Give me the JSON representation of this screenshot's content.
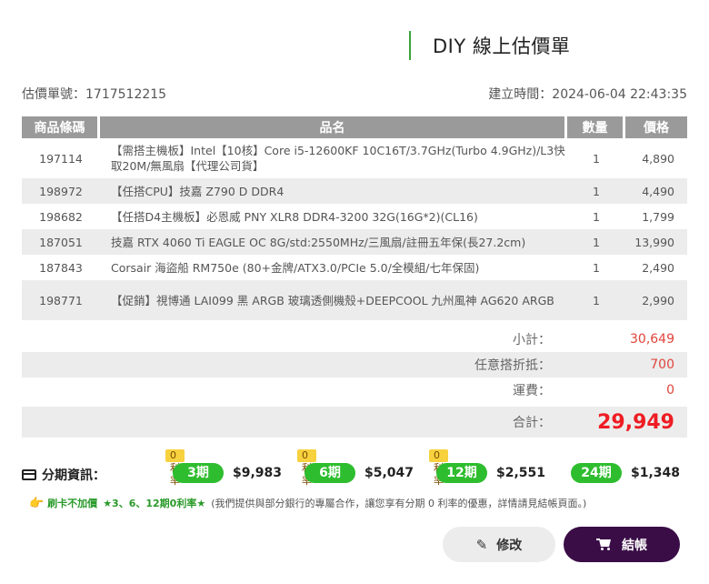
{
  "header": {
    "title": "DIY 線上估價單"
  },
  "meta": {
    "quote_no": "估價單號：1717512215",
    "created": "建立時間：2024-06-04 22:43:35"
  },
  "table": {
    "columns": [
      "商品條碼",
      "品名",
      "數量",
      "價格"
    ],
    "rows": [
      {
        "code": "197114",
        "name": "【需搭主機板】Intel【10核】Core i5-12600KF 10C16T/3.7GHz(Turbo 4.9GHz)/L3快取20M/無風扇【代理公司貨】",
        "qty": "1",
        "price": "4,890"
      },
      {
        "code": "198972",
        "name": "【任搭CPU】技嘉 Z790 D DDR4",
        "qty": "1",
        "price": "4,490"
      },
      {
        "code": "198682",
        "name": "【任搭D4主機板】必恩威 PNY XLR8 DDR4-3200 32G(16G*2)(CL16)",
        "qty": "1",
        "price": "1,799"
      },
      {
        "code": "187051",
        "name": "技嘉 RTX 4060 Ti EAGLE OC 8G/std:2550MHz/三風扇/註冊五年保(長27.2cm)",
        "qty": "1",
        "price": "13,990"
      },
      {
        "code": "187843",
        "name": "Corsair 海盜船 RM750e (80+金牌/ATX3.0/PCIe 5.0/全模組/七年保固)",
        "qty": "1",
        "price": "2,490"
      },
      {
        "code": "198771",
        "name": "【促銷】視博通 LAI099 黑 ARGB 玻璃透側機殼+DEEPCOOL 九州風神 AG620 ARGB",
        "qty": "1",
        "price": "2,990"
      }
    ]
  },
  "summary": {
    "subtotal_label": "小計：",
    "subtotal": "30,649",
    "discount_label": "任意搭折抵：",
    "discount": "700",
    "shipping_label": "運費：",
    "shipping": "0",
    "total_label": "合計：",
    "total": "29,949"
  },
  "installment": {
    "label": "分期資訊：",
    "plans": [
      {
        "tag": "0利率",
        "term": "3期",
        "price": "$9,983"
      },
      {
        "tag": "0利率",
        "term": "6期",
        "price": "$5,047"
      },
      {
        "tag": "0利率",
        "term": "12期",
        "price": "$2,551"
      },
      {
        "tag": "",
        "term": "24期",
        "price": "$1,348"
      }
    ]
  },
  "promo": {
    "a": "刷卡不加價",
    "b": "★3、6、12期0利率★",
    "c": "(我們提供與部分銀行的專屬合作，讓您享有分期 0 利率的優惠，詳情請見結帳頁面。)"
  },
  "buttons": {
    "edit": "修改",
    "checkout": "結帳"
  },
  "colors": {
    "accent_green": "#2ebd2e",
    "checkout_bg": "#3a0d47",
    "price_red": "#ee1d23"
  }
}
